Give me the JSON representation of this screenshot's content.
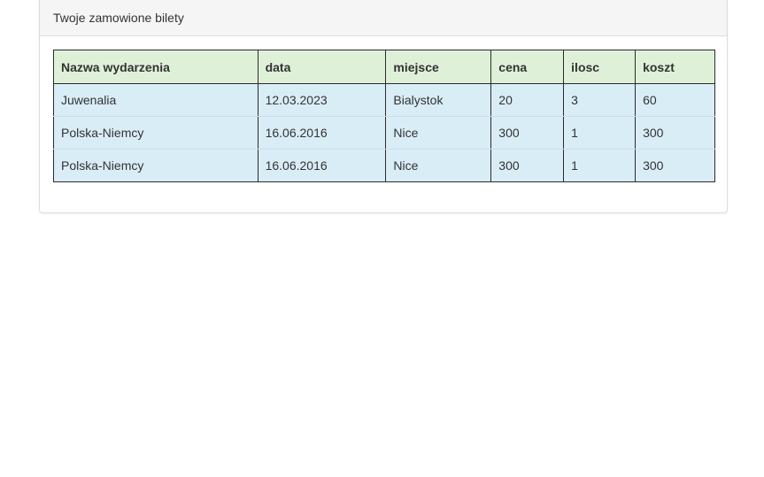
{
  "panel": {
    "title": "Twoje zamowione bilety"
  },
  "table": {
    "headers": [
      "Nazwa wydarzenia",
      "data",
      "miejsce",
      "cena",
      "ilosc",
      "koszt"
    ],
    "rows": [
      [
        "Juwenalia",
        "12.03.2023",
        "Bialystok",
        "20",
        "3",
        "60"
      ],
      [
        "Polska-Niemcy",
        "16.06.2016",
        "Nice",
        "300",
        "1",
        "300"
      ],
      [
        "Polska-Niemcy",
        "16.06.2016",
        "Nice",
        "300",
        "1",
        "300"
      ]
    ]
  },
  "colors": {
    "header_bg": "#dff0d8",
    "row_bg": "#d9edf7",
    "panel_heading_bg": "#f5f5f5"
  }
}
